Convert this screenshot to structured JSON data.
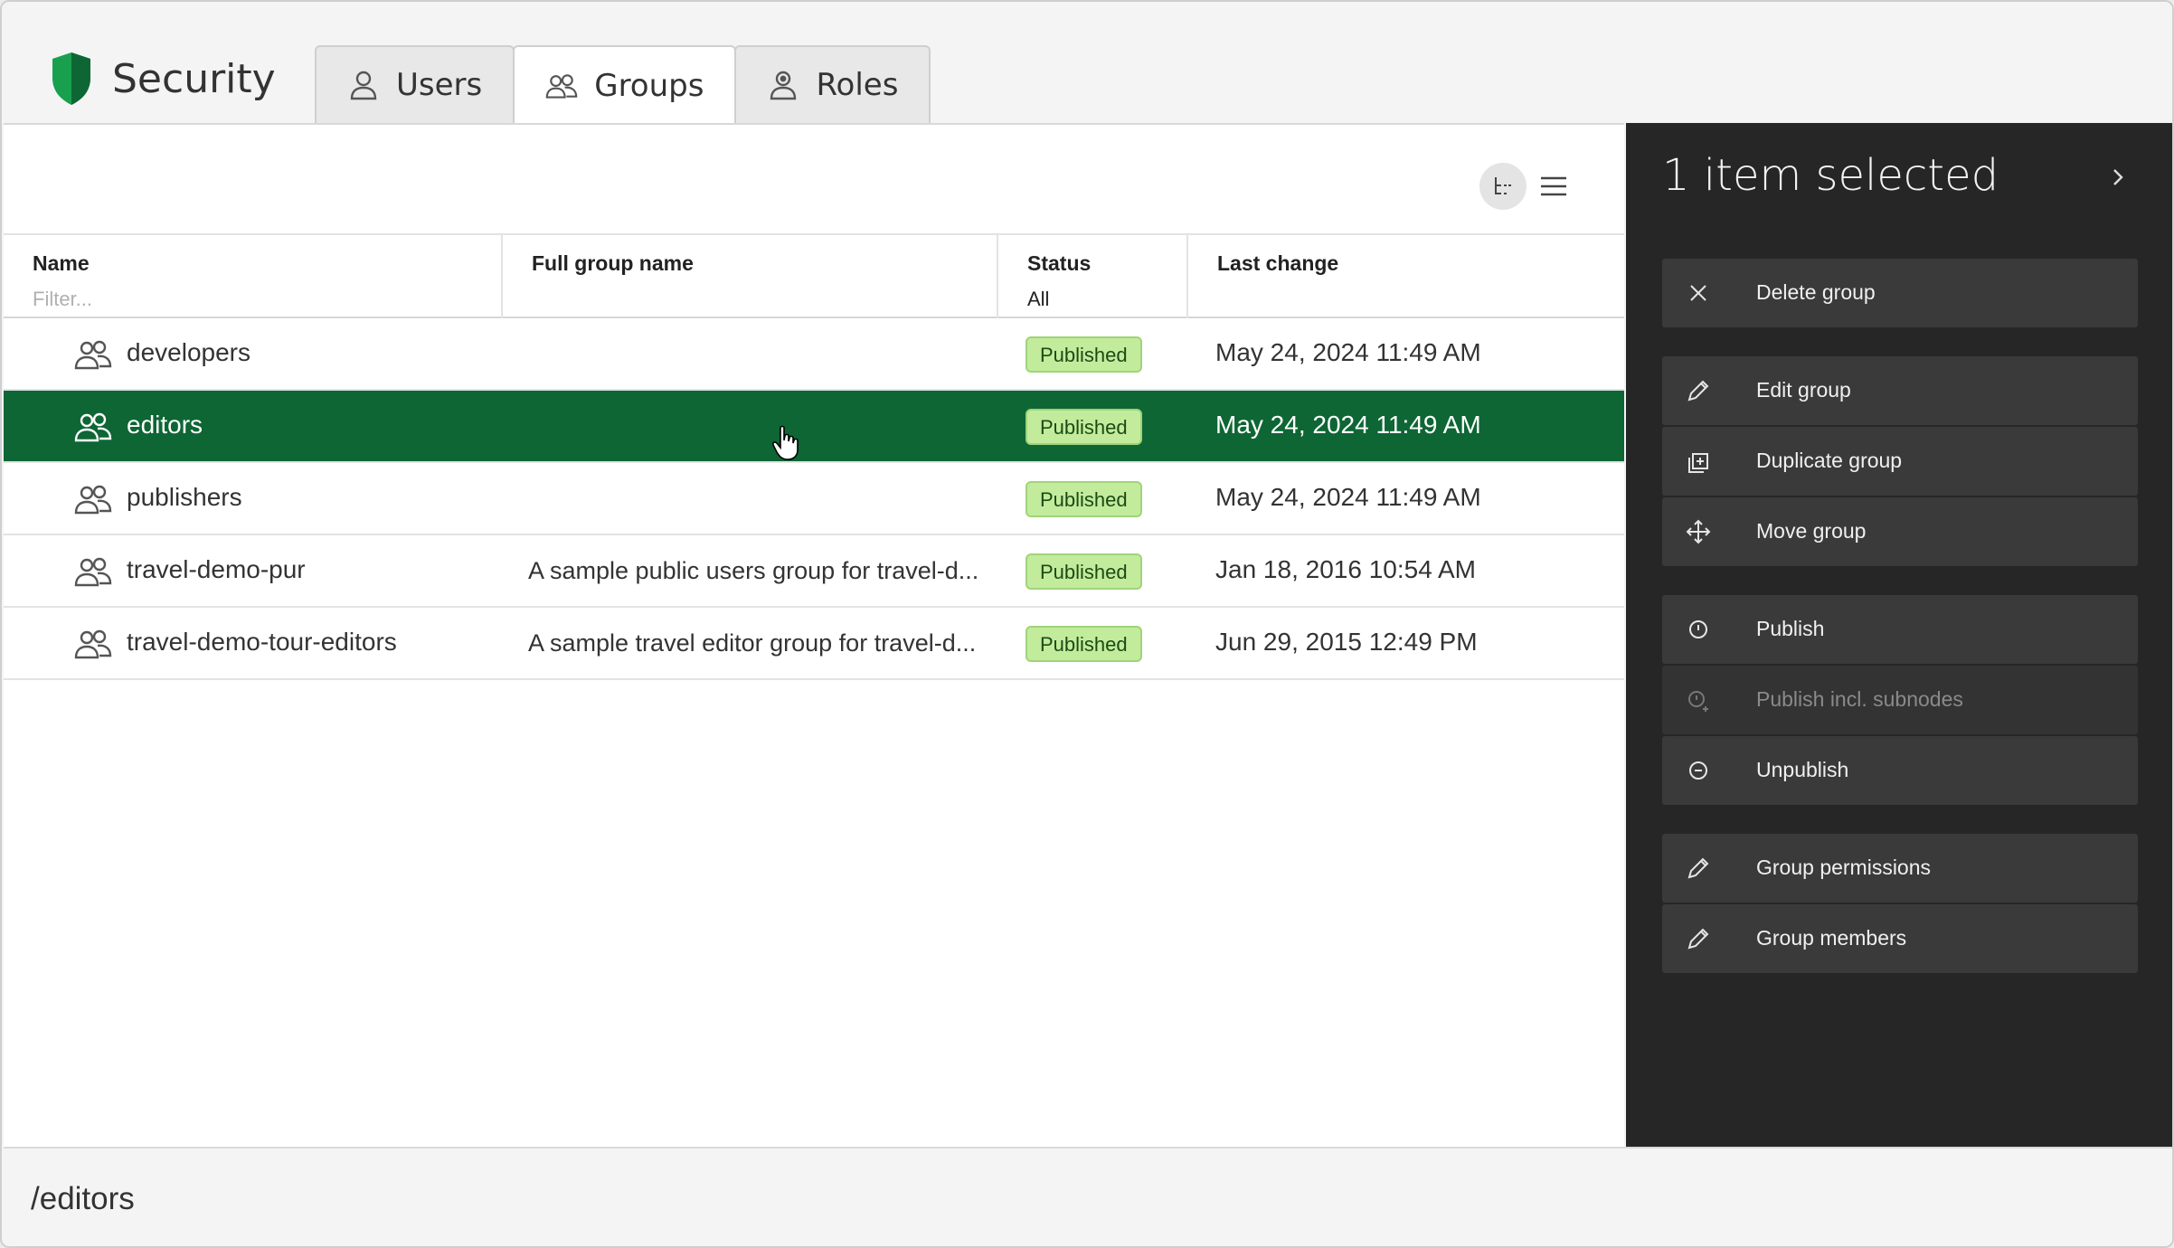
{
  "app": {
    "title": "Security",
    "accent": "#0d6634"
  },
  "tabs": [
    {
      "label": "Users",
      "icon": "user-icon"
    },
    {
      "label": "Groups",
      "icon": "group-icon",
      "active": true
    },
    {
      "label": "Roles",
      "icon": "role-icon"
    }
  ],
  "grid": {
    "columns": {
      "name": {
        "label": "Name",
        "filter_placeholder": "Filter..."
      },
      "fullname": {
        "label": "Full group name"
      },
      "status": {
        "label": "Status",
        "filter_value": "All"
      },
      "lastchange": {
        "label": "Last change"
      }
    },
    "rows": [
      {
        "name": "developers",
        "fullname": "",
        "status": "Published",
        "date": "May 24, 2024 11:49 AM"
      },
      {
        "name": "editors",
        "fullname": "",
        "status": "Published",
        "date": "May 24, 2024 11:49 AM",
        "selected": true
      },
      {
        "name": "publishers",
        "fullname": "",
        "status": "Published",
        "date": "May 24, 2024 11:49 AM"
      },
      {
        "name": "travel-demo-pur",
        "fullname": "A sample public users group for travel-d...",
        "status": "Published",
        "date": "Jan 18, 2016 10:54 AM"
      },
      {
        "name": "travel-demo-tour-editors",
        "fullname": "A sample travel editor group for travel-d...",
        "status": "Published",
        "date": "Jun 29, 2015 12:49 PM"
      }
    ]
  },
  "panel": {
    "title": "1 item selected",
    "actions": [
      {
        "label": "Delete group",
        "icon": "close-icon"
      },
      {
        "label": "Edit group",
        "icon": "pencil-icon"
      },
      {
        "label": "Duplicate group",
        "icon": "duplicate-icon"
      },
      {
        "label": "Move group",
        "icon": "move-icon"
      },
      {
        "label": "Publish",
        "icon": "publish-icon"
      },
      {
        "label": "Publish incl. subnodes",
        "icon": "publish-subnodes-icon",
        "disabled": true
      },
      {
        "label": "Unpublish",
        "icon": "unpublish-icon"
      },
      {
        "label": "Group permissions",
        "icon": "pencil-icon"
      },
      {
        "label": "Group members",
        "icon": "pencil-icon"
      }
    ]
  },
  "footer": {
    "path": "/editors"
  }
}
